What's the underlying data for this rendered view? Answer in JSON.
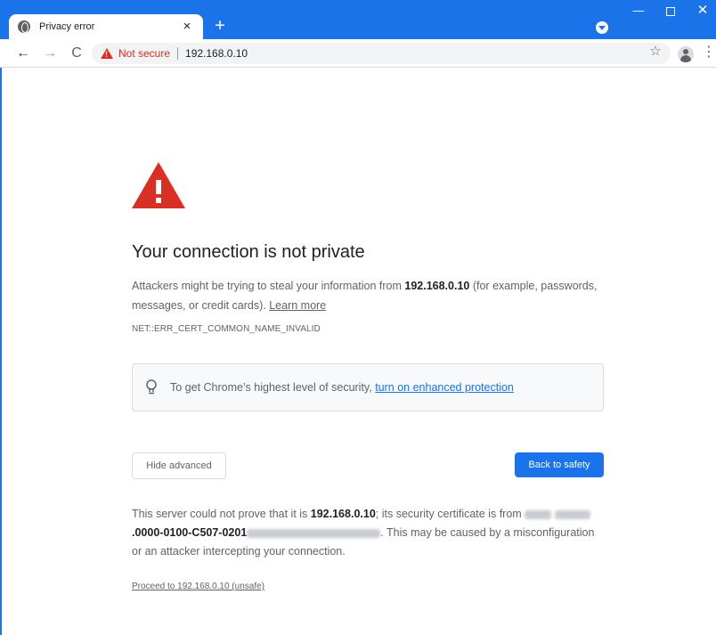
{
  "browser": {
    "tab_title": "Privacy error",
    "tab_close": "×",
    "new_tab": "+",
    "window_minimize": "—",
    "window_close": "✕",
    "omnibox": {
      "security_label": "Not secure",
      "url": "192.168.0.10"
    },
    "icons": {
      "back": "←",
      "forward": "→",
      "reload": "C",
      "bookmark": "☆",
      "menu": "⋮"
    },
    "accent_color": "#1a73e8",
    "danger_color": "#d93025"
  },
  "interstitial": {
    "headline": "Your connection is not private",
    "explanation_prefix": "Attackers might be trying to steal your information from ",
    "explanation_host": "192.168.0.10",
    "explanation_suffix": " (for example, passwords, messages, or credit cards). ",
    "learn_more": "Learn more",
    "error_code": "NET::ERR_CERT_COMMON_NAME_INVALID",
    "enhanced_prefix": "To get Chrome’s highest level of security, ",
    "enhanced_link": "turn on enhanced protection",
    "hide_advanced": "Hide advanced",
    "back_to_safety": "Back to safety",
    "details_prefix": "This server could not prove that it is ",
    "details_host": "192.168.0.10",
    "details_mid": "; its security certificate is from ",
    "details_cert": ".0000-0100-C507-0201",
    "details_suffix": ". This may be caused by a misconfiguration or an attacker intercepting your connection.",
    "proceed_link": "Proceed to 192.168.0.10 (unsafe)"
  }
}
